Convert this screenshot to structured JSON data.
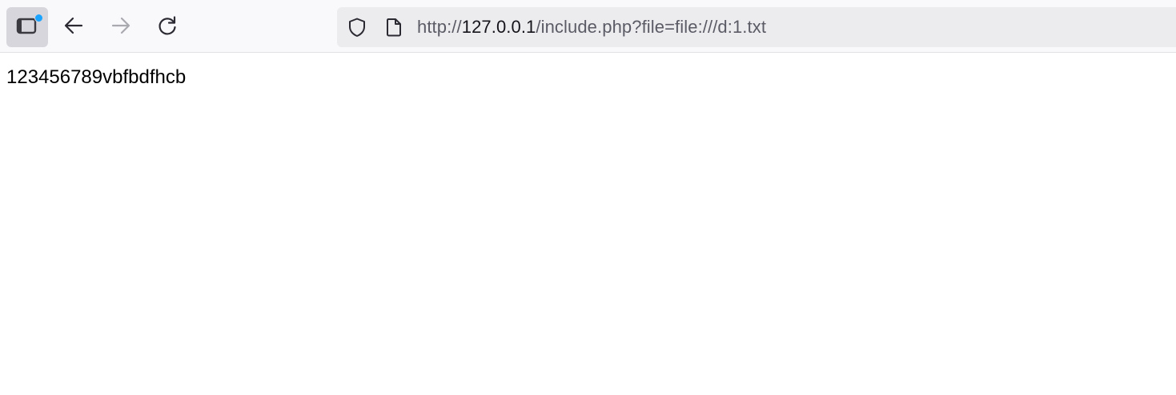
{
  "browser": {
    "url": {
      "scheme": "http://",
      "host": "127.0.0.1",
      "path": "/include.php?file=file:///d:1.txt"
    },
    "icons": {
      "tab_overview": "tab-overview-icon",
      "back": "arrow-left-icon",
      "forward": "arrow-right-icon",
      "reload": "reload-icon",
      "tracking_protection": "shield-icon",
      "page_info": "page-icon"
    },
    "colors": {
      "notification_dot": "#1aa3ff"
    }
  },
  "page": {
    "body_text": "123456789vbfbdfhcb"
  }
}
